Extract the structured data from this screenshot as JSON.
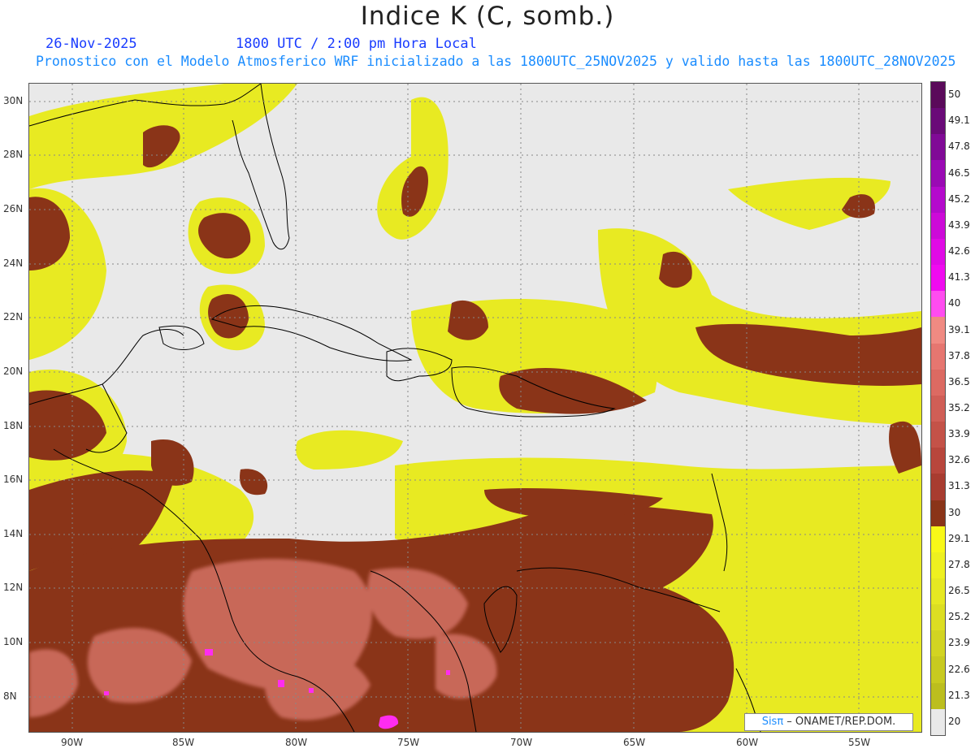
{
  "title": "Indice K (C, somb.)",
  "date": "26-Nov-2025",
  "time": "1800 UTC / 2:00 pm Hora Local",
  "forecast_line": "Pronostico con el Modelo Atmosferico WRF inicializado a las 1800UTC_25NOV2025 y valido hasta las  1800UTC_28NOV2025",
  "credit": {
    "brand": "Sisπ",
    "text": " – ONAMET/REP.DOM."
  },
  "lat_labels": [
    "30N",
    "28N",
    "26N",
    "24N",
    "22N",
    "20N",
    "18N",
    "16N",
    "14N",
    "12N",
    "10N",
    "8N"
  ],
  "lon_labels": [
    "90W",
    "85W",
    "80W",
    "75W",
    "70W",
    "65W",
    "60W",
    "55W"
  ],
  "colorbar": {
    "labels": [
      "50",
      "49.1",
      "47.8",
      "46.5",
      "45.2",
      "43.9",
      "42.6",
      "41.3",
      "40",
      "39.1",
      "37.8",
      "36.5",
      "35.2",
      "33.9",
      "32.6",
      "31.3",
      "30",
      "29.1",
      "27.8",
      "26.5",
      "25.2",
      "23.9",
      "22.6",
      "21.3",
      "20"
    ],
    "colors": [
      "#5a0a5a",
      "#6a0a78",
      "#800a96",
      "#9a0ab4",
      "#b40acc",
      "#cc0ad8",
      "#e00ae6",
      "#f00af0",
      "#ff4cf0",
      "#f08a82",
      "#e67670",
      "#dc6a62",
      "#d05e56",
      "#c45248",
      "#b8463c",
      "#a83c30",
      "#8a3418",
      "#f8f818",
      "#eef020",
      "#e6e822",
      "#dcde22",
      "#d2d422",
      "#c8ca20",
      "#bcbe1e",
      "#e9e9e9"
    ]
  },
  "legend_colors": {
    "no_data": "#e9e9e9",
    "yellow": "#e8ea22",
    "brown": "#8a3418",
    "salmon": "#c86858",
    "magenta": "#ff2cf0",
    "coast": "#000000"
  }
}
